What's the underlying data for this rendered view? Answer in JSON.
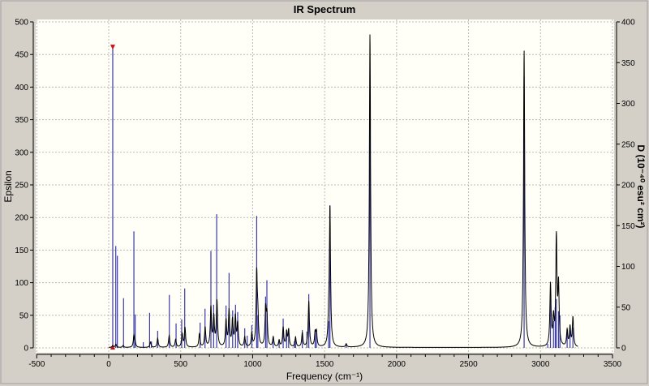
{
  "chart_data": {
    "type": "line",
    "title": "IR Spectrum",
    "xlabel": "Frequency (cm⁻¹)",
    "ylabel": "Epsilon",
    "y2label": "D (10⁻⁴⁰ esu² cm²)",
    "xlim": [
      -500,
      3500
    ],
    "ylim": [
      0,
      500
    ],
    "y2lim": [
      0,
      400
    ],
    "xticks": [
      -500,
      0,
      500,
      1000,
      1500,
      2000,
      2500,
      3000,
      3500
    ],
    "yticks": [
      0,
      50,
      100,
      150,
      200,
      250,
      300,
      350,
      400,
      450,
      500
    ],
    "y2ticks": [
      0,
      50,
      100,
      150,
      200,
      250,
      300,
      350,
      400
    ],
    "grid": true,
    "selected_mode_frequency": 28,
    "colors": {
      "spectrum": "#000000",
      "sticks": "#3a3aa8",
      "marker": "#d01010",
      "plot_bg": "#fffff8",
      "frame": "#d4d0c8"
    },
    "series": [
      {
        "name": "Epsilon spectrum",
        "axis": "left",
        "peaks": [
          [
            28,
            3
          ],
          [
            50,
            5
          ],
          [
            100,
            3
          ],
          [
            175,
            18
          ],
          [
            184,
            6
          ],
          [
            290,
            8
          ],
          [
            340,
            14
          ],
          [
            420,
            18
          ],
          [
            465,
            12
          ],
          [
            510,
            20
          ],
          [
            530,
            30
          ],
          [
            630,
            20
          ],
          [
            670,
            30
          ],
          [
            710,
            60
          ],
          [
            730,
            45
          ],
          [
            752,
            70
          ],
          [
            815,
            40
          ],
          [
            836,
            55
          ],
          [
            860,
            40
          ],
          [
            880,
            45
          ],
          [
            896,
            35
          ],
          [
            945,
            15
          ],
          [
            994,
            20
          ],
          [
            1028,
            110
          ],
          [
            1036,
            40
          ],
          [
            1090,
            55
          ],
          [
            1099,
            45
          ],
          [
            1143,
            15
          ],
          [
            1184,
            10
          ],
          [
            1212,
            30
          ],
          [
            1236,
            22
          ],
          [
            1250,
            25
          ],
          [
            1298,
            15
          ],
          [
            1345,
            22
          ],
          [
            1390,
            70
          ],
          [
            1434,
            20
          ],
          [
            1443,
            22
          ],
          [
            1528,
            30
          ],
          [
            1537,
            210
          ],
          [
            1650,
            5
          ],
          [
            1815,
            480
          ],
          [
            2886,
            455
          ],
          [
            3069,
            95
          ],
          [
            3090,
            40
          ],
          [
            3110,
            165
          ],
          [
            3125,
            90
          ],
          [
            3185,
            25
          ],
          [
            3205,
            30
          ],
          [
            3225,
            45
          ]
        ]
      },
      {
        "name": "Dipole strength sticks",
        "axis": "right",
        "sticks": [
          [
            28,
            368
          ],
          [
            49,
            125
          ],
          [
            60,
            113
          ],
          [
            103,
            61
          ],
          [
            175,
            143
          ],
          [
            184,
            41
          ],
          [
            240,
            7
          ],
          [
            284,
            43
          ],
          [
            297,
            8
          ],
          [
            340,
            21
          ],
          [
            421,
            65
          ],
          [
            468,
            30
          ],
          [
            507,
            35
          ],
          [
            528,
            73
          ],
          [
            635,
            31
          ],
          [
            669,
            48
          ],
          [
            710,
            119
          ],
          [
            729,
            53
          ],
          [
            750,
            164
          ],
          [
            815,
            52
          ],
          [
            836,
            92
          ],
          [
            861,
            46
          ],
          [
            881,
            53
          ],
          [
            896,
            44
          ],
          [
            945,
            24
          ],
          [
            962,
            15
          ],
          [
            994,
            28
          ],
          [
            1028,
            162
          ],
          [
            1036,
            40
          ],
          [
            1090,
            63
          ],
          [
            1099,
            83
          ],
          [
            1142,
            13
          ],
          [
            1184,
            9
          ],
          [
            1212,
            36
          ],
          [
            1236,
            22
          ],
          [
            1250,
            24
          ],
          [
            1290,
            8
          ],
          [
            1298,
            13
          ],
          [
            1345,
            22
          ],
          [
            1377,
            20
          ],
          [
            1390,
            66
          ],
          [
            1434,
            22
          ],
          [
            1443,
            22
          ],
          [
            1528,
            33
          ],
          [
            1537,
            175
          ],
          [
            1650,
            5
          ],
          [
            1815,
            310
          ],
          [
            2886,
            333
          ],
          [
            3050,
            5
          ],
          [
            3069,
            60
          ],
          [
            3090,
            33
          ],
          [
            3102,
            50
          ],
          [
            3110,
            60
          ],
          [
            3125,
            45
          ],
          [
            3135,
            40
          ],
          [
            3185,
            20
          ],
          [
            3205,
            22
          ],
          [
            3225,
            25
          ]
        ]
      }
    ]
  }
}
